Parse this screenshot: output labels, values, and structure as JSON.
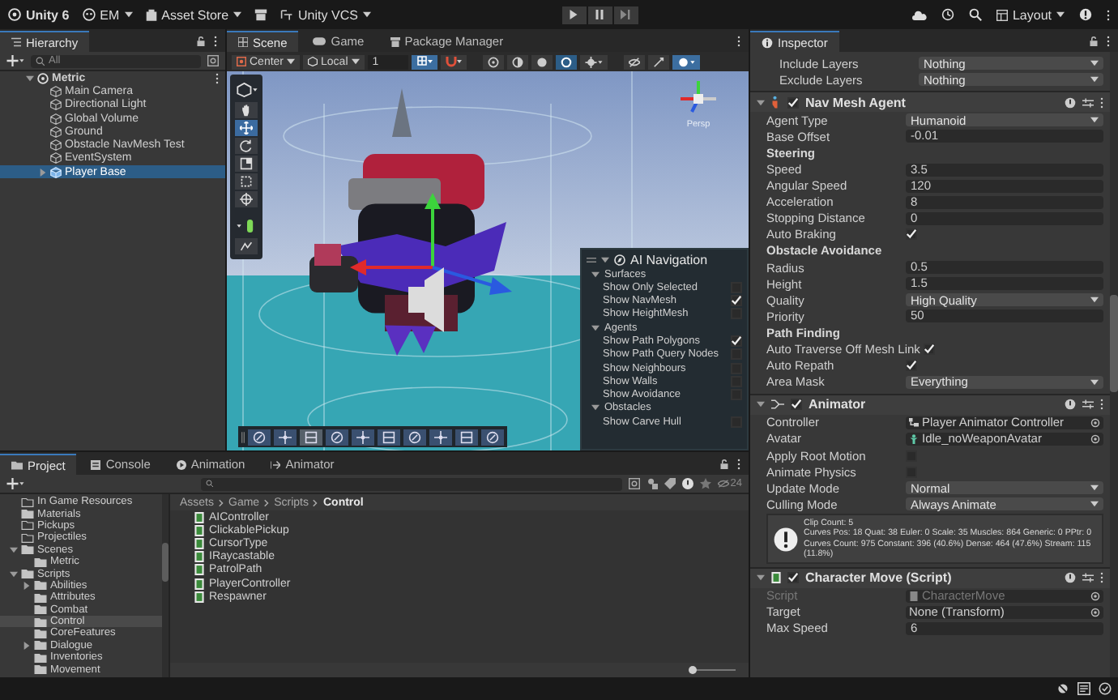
{
  "toolbar": {
    "version": "Unity 6",
    "account": "EM",
    "asset_store": "Asset Store",
    "vcs": "Unity VCS",
    "layout": "Layout"
  },
  "hierarchy": {
    "title": "Hierarchy",
    "search_placeholder": "All",
    "scene": {
      "name": "Metric",
      "expanded": true,
      "children": [
        {
          "name": "Main Camera",
          "kind": "object",
          "selected": false
        },
        {
          "name": "Directional Light",
          "kind": "object",
          "selected": false
        },
        {
          "name": "Global Volume",
          "kind": "object",
          "selected": false
        },
        {
          "name": "Ground",
          "kind": "object",
          "selected": false
        },
        {
          "name": "Obstacle NavMesh Test",
          "kind": "object",
          "selected": false
        },
        {
          "name": "EventSystem",
          "kind": "object",
          "selected": false
        },
        {
          "name": "Player Base",
          "kind": "prefab",
          "selected": true,
          "expanded": false
        }
      ]
    }
  },
  "scene": {
    "tabs": [
      {
        "label": "Scene",
        "kind": "scene",
        "selected": true
      },
      {
        "label": "Game",
        "kind": "game",
        "selected": false
      },
      {
        "label": "Package Manager",
        "kind": "package",
        "selected": false
      }
    ],
    "pivot": "Center",
    "space": "Local",
    "grid_size": "1",
    "axis_label": "Persp",
    "tools": [
      {
        "kind": "hand",
        "selected": false
      },
      {
        "kind": "move",
        "selected": true
      },
      {
        "kind": "rotate",
        "selected": false
      },
      {
        "kind": "scale",
        "selected": false
      },
      {
        "kind": "rect",
        "selected": false
      },
      {
        "kind": "transform",
        "selected": false
      }
    ],
    "ai_navigation": {
      "title": "AI Navigation",
      "sections": [
        {
          "title": "Surfaces",
          "expanded": true,
          "options": [
            {
              "label": "Show Only Selected",
              "checked": false
            },
            {
              "label": "Show NavMesh",
              "checked": true
            },
            {
              "label": "Show HeightMesh",
              "checked": false
            }
          ]
        },
        {
          "title": "Agents",
          "expanded": true,
          "options": [
            {
              "label": "Show Path Polygons",
              "checked": true
            },
            {
              "label": "Show Path Query Nodes",
              "checked": false
            },
            {
              "label": "Show Neighbours",
              "checked": false
            },
            {
              "label": "Show Walls",
              "checked": false
            },
            {
              "label": "Show Avoidance",
              "checked": false
            }
          ]
        },
        {
          "title": "Obstacles",
          "expanded": true,
          "options": [
            {
              "label": "Show Carve Hull",
              "checked": false
            }
          ]
        }
      ]
    }
  },
  "inspector": {
    "title": "Inspector",
    "fields": [
      {
        "kind": "dropdown",
        "label": "Include Layers",
        "value": "Nothing"
      },
      {
        "kind": "dropdown",
        "label": "Exclude Layers",
        "value": "Nothing"
      }
    ],
    "components": [
      {
        "title": "Nav Mesh Agent",
        "kind": "agent",
        "enabled": true,
        "expanded": true,
        "fields": [
          {
            "kind": "dropdown",
            "label": "Agent Type",
            "value": "Humanoid"
          },
          {
            "kind": "number",
            "label": "Base Offset",
            "value": "-0.01"
          },
          {
            "kind": "heading",
            "label": "Steering"
          },
          {
            "kind": "number",
            "label": "Speed",
            "value": "3.5"
          },
          {
            "kind": "number",
            "label": "Angular Speed",
            "value": "120"
          },
          {
            "kind": "number",
            "label": "Acceleration",
            "value": "8"
          },
          {
            "kind": "number",
            "label": "Stopping Distance",
            "value": "0"
          },
          {
            "kind": "checkbox",
            "label": "Auto Braking",
            "checked": true
          },
          {
            "kind": "heading",
            "label": "Obstacle Avoidance"
          },
          {
            "kind": "number",
            "label": "Radius",
            "value": "0.5"
          },
          {
            "kind": "number",
            "label": "Height",
            "value": "1.5"
          },
          {
            "kind": "dropdown",
            "label": "Quality",
            "value": "High Quality"
          },
          {
            "kind": "number",
            "label": "Priority",
            "value": "50"
          },
          {
            "kind": "heading",
            "label": "Path Finding"
          },
          {
            "kind": "checkbox",
            "label": "Auto Traverse Off Mesh Link",
            "checked": true
          },
          {
            "kind": "checkbox",
            "label": "Auto Repath",
            "checked": true
          },
          {
            "kind": "dropdown",
            "label": "Area Mask",
            "value": "Everything"
          }
        ]
      },
      {
        "title": "Animator",
        "kind": "animator",
        "enabled": true,
        "expanded": true,
        "fields": [
          {
            "kind": "controller",
            "label": "Controller",
            "value": "Player Animator Controller",
            "disabled": false
          },
          {
            "kind": "avatar",
            "label": "Avatar",
            "value": "Idle_noWeaponAvatar",
            "disabled": false
          },
          {
            "kind": "checkbox",
            "label": "Apply Root Motion",
            "checked": false
          },
          {
            "kind": "checkbox",
            "label": "Animate Physics",
            "checked": false
          },
          {
            "kind": "dropdown",
            "label": "Update Mode",
            "value": "Normal"
          },
          {
            "kind": "dropdown",
            "label": "Culling Mode",
            "value": "Always Animate"
          },
          {
            "kind": "info",
            "lines": [
              "Clip Count: 5",
              "Curves Pos: 18 Quat: 38 Euler: 0 Scale: 35 Muscles: 864 Generic: 0 PPtr: 0",
              "Curves Count: 975 Constant: 396 (40.6%) Dense: 464 (47.6%) Stream: 115 (11.8%)"
            ]
          }
        ]
      },
      {
        "title": "Character Move (Script)",
        "kind": "script",
        "enabled": true,
        "expanded": true,
        "fields": [
          {
            "kind": "script",
            "label": "Script",
            "value": "CharacterMove",
            "disabled": true
          },
          {
            "kind": "object",
            "label": "Target",
            "value": "None (Transform)",
            "disabled": false
          },
          {
            "kind": "number",
            "label": "Max Speed",
            "value": "6"
          }
        ]
      }
    ]
  },
  "project": {
    "tabs": [
      {
        "label": "Project",
        "kind": "project",
        "selected": true
      },
      {
        "label": "Console",
        "kind": "console",
        "selected": false
      },
      {
        "label": "Animation",
        "kind": "animation",
        "selected": false
      },
      {
        "label": "Animator",
        "kind": "animator",
        "selected": false
      }
    ],
    "hidden_count": "24",
    "folders": [
      {
        "name": "In Game Resources",
        "empty": true,
        "selected": false
      },
      {
        "name": "Materials",
        "empty": false,
        "selected": false
      },
      {
        "name": "Pickups",
        "empty": true,
        "selected": false
      },
      {
        "name": "Projectiles",
        "empty": true,
        "selected": false
      },
      {
        "name": "Scenes",
        "empty": false,
        "selected": false,
        "expanded": true,
        "children": [
          {
            "name": "Metric",
            "empty": false,
            "selected": false
          }
        ]
      },
      {
        "name": "Scripts",
        "empty": false,
        "selected": false,
        "expanded": true,
        "children": [
          {
            "name": "Abilities",
            "empty": false,
            "selected": false,
            "expanded": false
          },
          {
            "name": "Attributes",
            "empty": false,
            "selected": false
          },
          {
            "name": "Combat",
            "empty": false,
            "selected": false
          },
          {
            "name": "Control",
            "empty": false,
            "selected": true
          },
          {
            "name": "CoreFeatures",
            "empty": false,
            "selected": false
          },
          {
            "name": "Dialogue",
            "empty": false,
            "selected": false,
            "expanded": false
          },
          {
            "name": "Inventories",
            "empty": false,
            "selected": false
          },
          {
            "name": "Movement",
            "empty": false,
            "selected": false
          }
        ]
      }
    ],
    "breadcrumb": [
      "Assets",
      "Game",
      "Scripts",
      "Control"
    ],
    "files": [
      "AIController",
      "ClickablePickup",
      "CursorType",
      "IRaycastable",
      "PatrolPath",
      "PlayerController",
      "Respawner"
    ],
    "icon_size": {
      "level": 0.05
    }
  }
}
